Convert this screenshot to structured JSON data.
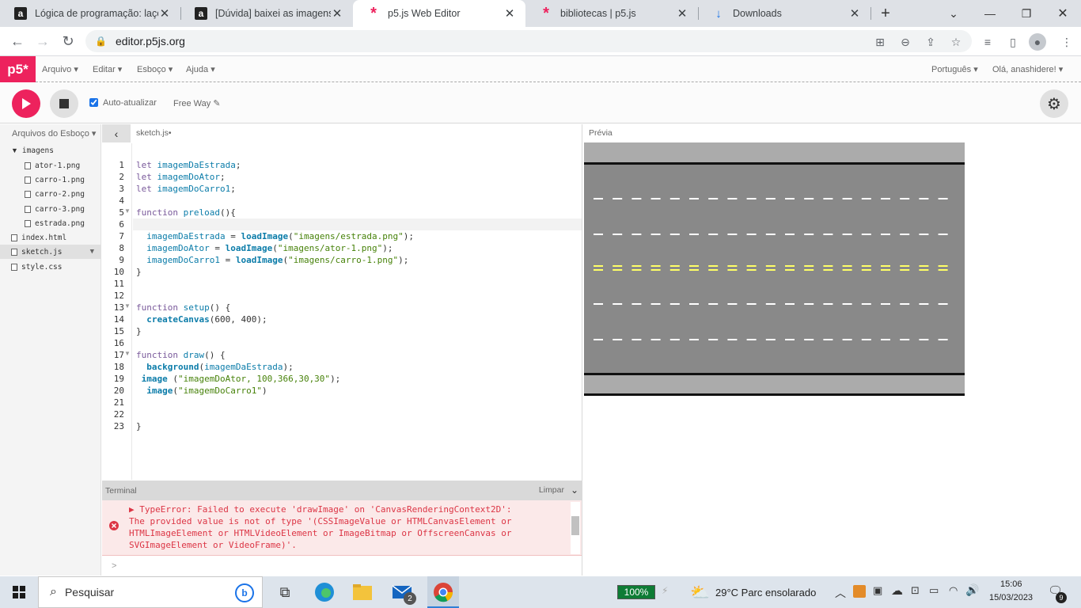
{
  "browser": {
    "tabs": [
      {
        "title": "Lógica de programação: laço",
        "favicon": "a"
      },
      {
        "title": "[Dúvida] baixei as imagens e",
        "favicon": "a"
      },
      {
        "title": "p5.js Web Editor",
        "favicon": "*"
      },
      {
        "title": "bibliotecas | p5.js",
        "favicon": "*"
      },
      {
        "title": "Downloads",
        "favicon": "↓"
      }
    ],
    "url": "editor.p5js.org"
  },
  "p5nav": {
    "logo": "p5*",
    "menus": [
      "Arquivo ▾",
      "Editar ▾",
      "Esboço ▾",
      "Ajuda ▾"
    ],
    "language": "Português ▾",
    "user": "Olá, anashidere! ▾"
  },
  "toolbar": {
    "auto_refresh": "Auto-atualizar",
    "sketch_name": "Free Way ✎"
  },
  "sidebar": {
    "header": "Arquivos do Esboço ▾",
    "folder": "imagens",
    "folder_files": [
      "ator-1.png",
      "carro-1.png",
      "carro-2.png",
      "carro-3.png",
      "estrada.png"
    ],
    "root_files": [
      "index.html",
      "sketch.js",
      "style.css"
    ]
  },
  "editor": {
    "filename": "sketch.js•",
    "line_numbers": [
      "1",
      "2",
      "3",
      "4",
      "5",
      "6",
      "7",
      "8",
      "9",
      "10",
      "11",
      "12",
      "13",
      "14",
      "15",
      "16",
      "17",
      "18",
      "19",
      "20",
      "21",
      "22",
      "23"
    ]
  },
  "preview": {
    "label": "Prévia"
  },
  "terminal": {
    "label": "Terminal",
    "clear": "Limpar",
    "error": "▶ TypeError: Failed to execute 'drawImage' on 'CanvasRenderingContext2D':\nThe provided value is not of type '(CSSImageValue or HTMLCanvasElement or\nHTMLImageElement or HTMLVideoElement or ImageBitmap or OffscreenCanvas or\nSVGImageElement or VideoFrame)'.",
    "prompt": ">"
  },
  "taskbar": {
    "search": "Pesquisar",
    "battery": "100%",
    "weather": "29°C  Parc ensolarado",
    "time": "15:06",
    "date": "15/03/2023",
    "notif": "9",
    "mail_badge": "2"
  },
  "colors": {
    "p5_pink": "#ed225d",
    "road": "#898989",
    "shoulder": "#ababab",
    "yellow_line": "#ffff66"
  }
}
